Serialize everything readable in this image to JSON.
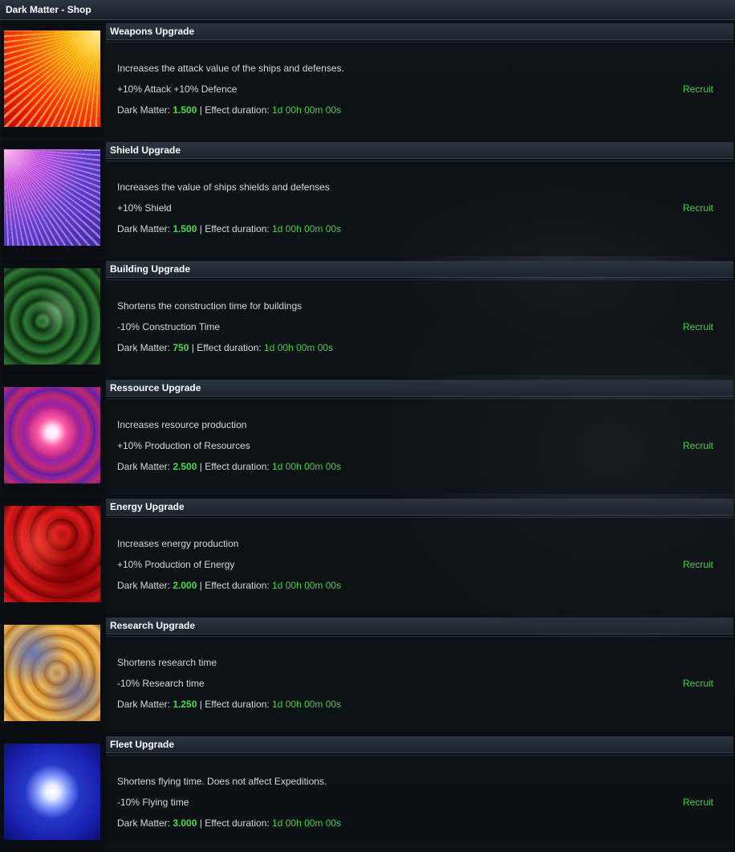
{
  "shop": {
    "title": "Dark Matter - Shop",
    "cost_label": "Dark Matter:",
    "separator": "|",
    "duration_label": "Effect duration:",
    "recruit_label": "Recruit"
  },
  "items": [
    {
      "name": "Weapons Upgrade",
      "image": "weapons-upgrade-image",
      "description": "Increases the attack value of the ships and defenses.",
      "effect": "+10% Attack +10% Defence",
      "cost": "1.500",
      "duration": "1d 00h 00m 00s"
    },
    {
      "name": "Shield Upgrade",
      "image": "shield-upgrade-image",
      "description": "Increases the value of ships shields and defenses",
      "effect": "+10% Shield",
      "cost": "1.500",
      "duration": "1d 00h 00m 00s"
    },
    {
      "name": "Building Upgrade",
      "image": "building-upgrade-image",
      "description": "Shortens the construction time for buildings",
      "effect": "-10% Construction Time",
      "cost": "750",
      "duration": "1d 00h 00m 00s"
    },
    {
      "name": "Ressource Upgrade",
      "image": "resource-upgrade-image",
      "description": "Increases resource production",
      "effect": "+10% Production of Resources",
      "cost": "2.500",
      "duration": "1d 00h 00m 00s"
    },
    {
      "name": "Energy Upgrade",
      "image": "energy-upgrade-image",
      "description": "Increases energy production",
      "effect": "+10% Production of Energy",
      "cost": "2.000",
      "duration": "1d 00h 00m 00s"
    },
    {
      "name": "Research Upgrade",
      "image": "research-upgrade-image",
      "description": "Shortens research time",
      "effect": "-10% Research time",
      "cost": "1.250",
      "duration": "1d 00h 00m 00s"
    },
    {
      "name": "Fleet Upgrade",
      "image": "fleet-upgrade-image",
      "description": "Shortens flying time. Does not affect Expeditions.",
      "effect": "-10% Flying time",
      "cost": "3.000",
      "duration": "1d 00h 00m 00s"
    }
  ],
  "colors": {
    "accent_green": "#3fd43f",
    "header_bg": "#2a3540",
    "page_bg": "#0b0f14"
  }
}
